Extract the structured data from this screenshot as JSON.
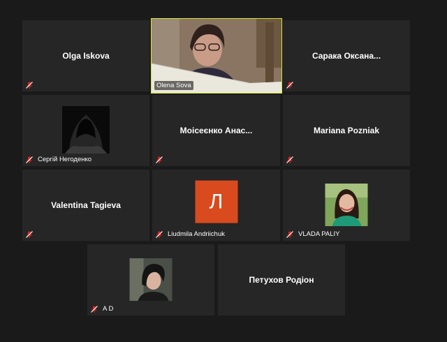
{
  "participants": [
    {
      "name": "Olga Iskova",
      "display": "center",
      "muted": true
    },
    {
      "name": "Olena Sova",
      "display": "video",
      "muted": false,
      "active_speaker": true
    },
    {
      "name": "Сарака Оксана...",
      "display": "center",
      "muted": true
    },
    {
      "name": "Сергій Негоденко",
      "display": "photo",
      "muted": true
    },
    {
      "name": "Моісеєнко Анас...",
      "display": "center",
      "muted": true
    },
    {
      "name": "Mariana Pozniak",
      "display": "center",
      "muted": true
    },
    {
      "name": "Valentina Tagieva",
      "display": "center",
      "muted": true
    },
    {
      "name": "Liudmila Andriichuk",
      "display": "initial",
      "initial": "Л",
      "muted": true
    },
    {
      "name": "VLADA PALIY",
      "display": "photo",
      "muted": true
    },
    {
      "name": "A D",
      "display": "photo",
      "muted": true
    },
    {
      "name": "Петухов Родіон",
      "display": "center",
      "muted": false
    }
  ],
  "colors": {
    "background": "#1a1a1a",
    "tile": "#262626",
    "active_speaker_border": "#d6e33a",
    "mute_icon": "#e02424",
    "initial_avatar": "#d94a1e"
  },
  "icons": {
    "mute": "microphone-muted-icon"
  }
}
